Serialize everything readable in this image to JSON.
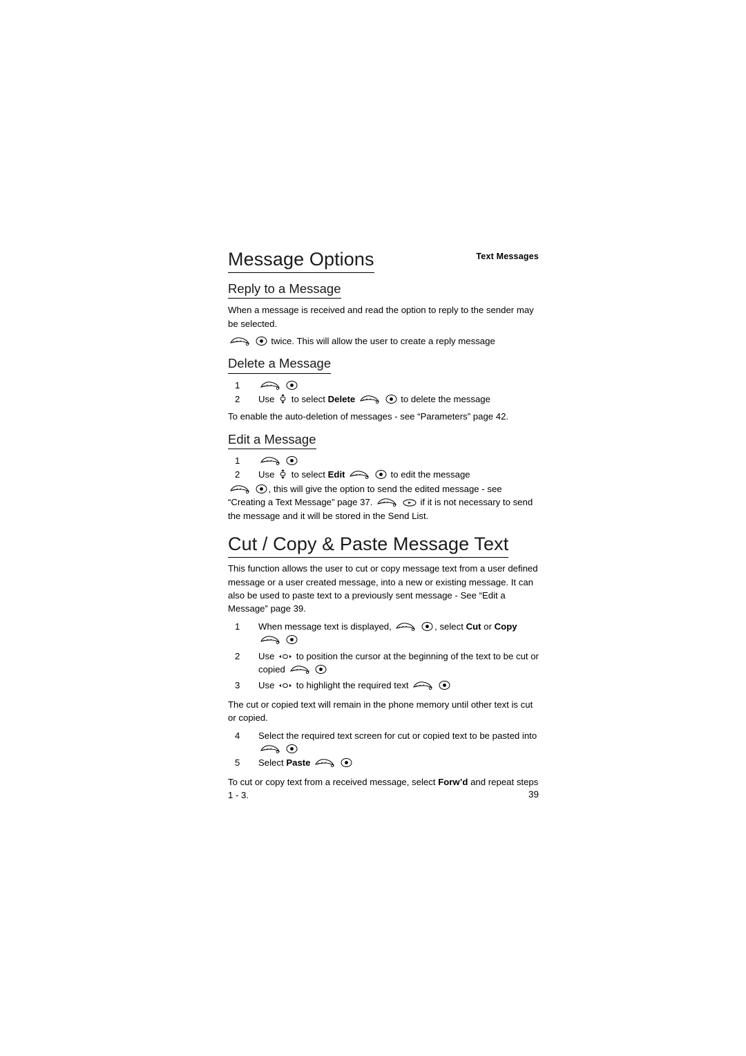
{
  "header": {
    "running_head": "Text Messages"
  },
  "sections": [
    {
      "id": "message-options",
      "title": "Message Options"
    }
  ],
  "message_options": {
    "title": "Message Options",
    "reply": {
      "title": "Reply to a Message",
      "paragraph": "When a message is received and read the option to reply to the sender may be selected.",
      "line_suffix": "twice. This will allow the user to create a reply message"
    },
    "delete": {
      "title": "Delete a Message",
      "step1_num": "1",
      "step2_num": "2",
      "step2_a": "Use",
      "step2_b": "to select",
      "step2_bold": "Delete",
      "step2_c": "to delete the message",
      "note": "To enable the auto-deletion of messages - see “Parameters” page 42."
    },
    "edit": {
      "title": "Edit a Message",
      "step1_num": "1",
      "step2_num": "2",
      "step2_a": "Use",
      "step2_b": "to select",
      "step2_bold": "Edit",
      "step2_c": "to edit the message",
      "para_a": ",  this will give the option to send the edited message - see “Creating a Text Message” page 37.",
      "para_b": "if it is not necessary to send the message and it will be stored in the Send List."
    }
  },
  "cut_copy": {
    "title": "Cut / Copy & Paste Message Text",
    "intro": "This function allows the user to cut or copy message text from a user defined message or a user created message, into a new or existing message. It can also be used to paste text to a previously sent message - See “Edit a Message” page 39.",
    "steps": [
      {
        "num": "1",
        "a": "When message text is displayed,",
        "b": ", select",
        "bold1": "Cut",
        "mid": "or",
        "bold2": "Copy"
      },
      {
        "num": "2",
        "a": "Use",
        "b": "to position the cursor at the beginning of the text to be cut or copied"
      },
      {
        "num": "3",
        "a": "Use",
        "b": "to highlight the required text"
      },
      {
        "num": "4",
        "a": "Select the required text screen for cut or copied text to be pasted into"
      },
      {
        "num": "5",
        "a": "Select",
        "bold1": "Paste"
      }
    ],
    "note_memory": "The cut or copied text will remain in the phone memory until other text is cut or copied.",
    "note_forward_a": "To cut or copy text from a received message, select",
    "note_forward_bold": "Forw’d",
    "note_forward_b": "and repeat steps 1 - 3."
  },
  "footer": {
    "page_number": "39"
  },
  "icons": {
    "soft_key": "soft-key-icon",
    "select_key": "select-key-icon",
    "nav_vertical": "navigation-up-down-icon",
    "nav_horizontal": "navigation-left-right-icon",
    "back_key": "back-key-icon"
  },
  "colors": {
    "text": "#000000",
    "heading": "#1a1a1a",
    "rule": "#000000",
    "background": "#ffffff"
  }
}
